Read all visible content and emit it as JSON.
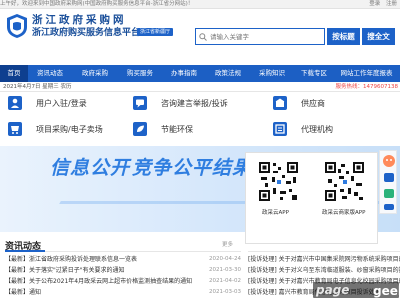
{
  "topbar": {
    "welcome": "上午好，欢迎来到中国政府采购网(中国政府购买服务信息平台-浙江省分网站)！",
    "links": [
      "登录",
      "注册"
    ]
  },
  "header": {
    "title_line1": "浙江政府采购网",
    "title_line2": "浙江政府购买服务信息平台",
    "region_tag": "浙江省新疆厅",
    "search_placeholder": "请输入关键字",
    "subject_button": "按标题",
    "search_button": "搜全文"
  },
  "nav": {
    "items": [
      "首页",
      "资讯动态",
      "政府采购",
      "购买服务",
      "办事指南",
      "政策法规",
      "采购知识",
      "下载专区",
      "网站工作年度报表"
    ],
    "active_index": 0
  },
  "datebar": {
    "date": "2021年4月7日 星期三 农历",
    "hotline": "服务热线：1479607138"
  },
  "services": [
    {
      "label": "用户入驻/登录",
      "icon": "user-login-icon"
    },
    {
      "label": "咨询建言举报/投诉",
      "icon": "consult-icon"
    },
    {
      "label": "供应商",
      "icon": "supplier-icon"
    },
    {
      "label": "项目采购/电子卖场",
      "icon": "mall-icon"
    },
    {
      "label": "节能环保",
      "icon": "eco-icon"
    },
    {
      "label": "代理机构",
      "icon": "agency-icon"
    }
  ],
  "banner": {
    "slogans": [
      "信息公开",
      "竞争公平",
      "结果"
    ]
  },
  "qr": {
    "items": [
      "政采云APP",
      "政采云商家版APP"
    ]
  },
  "news": {
    "section_title": "资讯动态",
    "more": "更多",
    "rows": [
      {
        "title": "【最新】浙江省政府采购投诉处理联系信息一览表",
        "date": "2020-04-24"
      },
      {
        "title": "【最新】关于落实\"过紧日子\"有关要求的通知",
        "date": "2021-03-30"
      },
      {
        "title": "【最新】关于公布2021年4月政采云网上超市价格监测抽查结果的通知",
        "date": "2021-04-02"
      },
      {
        "title": "【最新】通知",
        "date": "2021-03-03"
      }
    ]
  },
  "notices": {
    "rows": [
      "[投诉处理] 关于对嘉兴市中国集采院网污物系统采购项目的投诉处理",
      "[投诉处理] 关于对义乌至东湾临道服装、纱窗采购项目的投诉处理",
      "[投诉处理] 关于对嘉兴市教育局电子信息化校园采购项目的投诉处理",
      "[投诉处理] 嘉兴市教育局信息化采购项目投诉处理"
    ]
  },
  "watermark": {
    "left": "page",
    "right": "geek"
  },
  "colors": {
    "brand": "#1d62c8",
    "nav": "#1c5fc4",
    "nav_active": "#0e3f8f",
    "hotline": "#ee4444"
  }
}
